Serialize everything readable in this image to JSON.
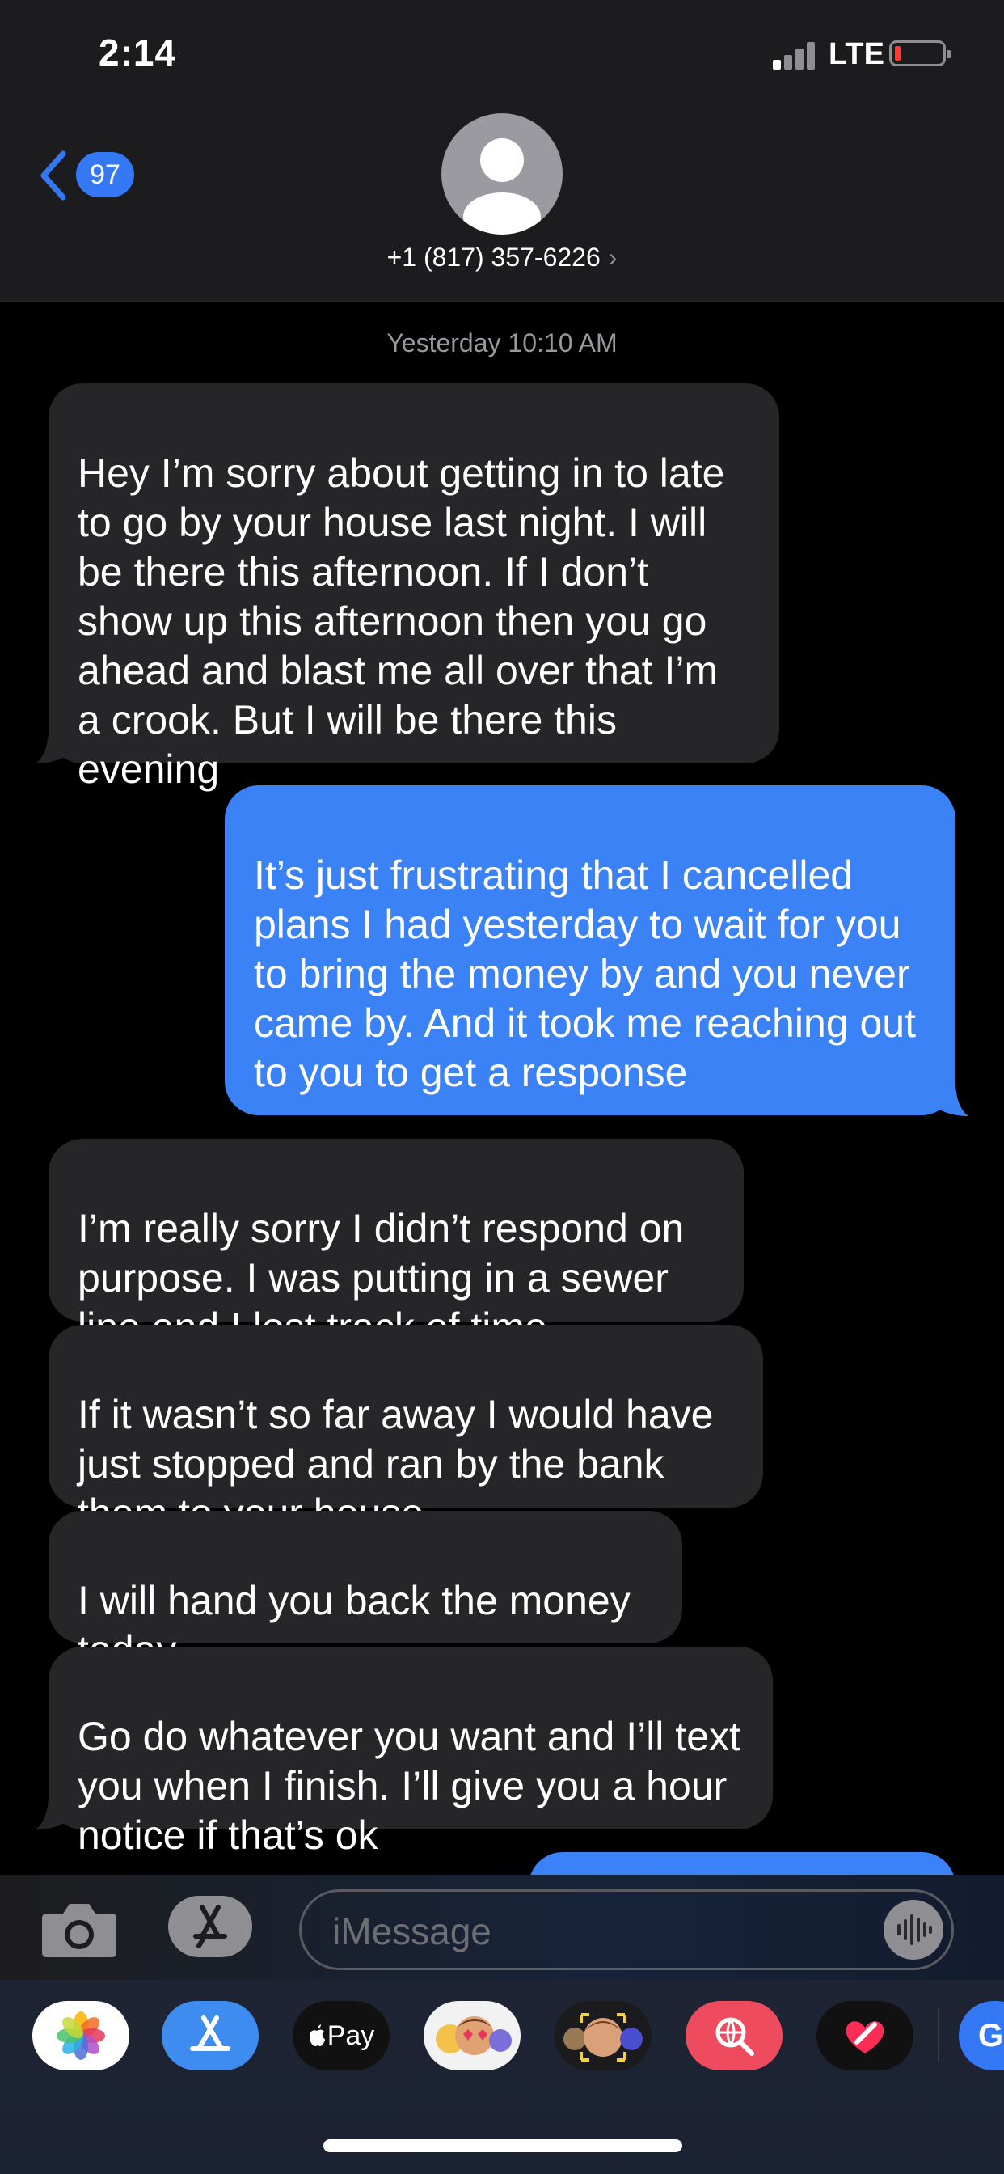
{
  "status_bar": {
    "time": "2:14",
    "network": "LTE"
  },
  "header": {
    "back_count": "97",
    "contact": "+1 (817) 357-6226",
    "chevron": "›"
  },
  "timestamp": "Yesterday 10:10 AM",
  "messages": [
    {
      "from": "them",
      "text": "Hey I’m sorry about  getting in to late to go by your house last night.  I will be there this afternoon.   If I don’t show up this afternoon then you go ahead and blast me all over that I’m a crook.     But I will be there this evening"
    },
    {
      "from": "me",
      "text": "It’s just frustrating that I cancelled plans I had yesterday to wait for you to bring the money by and you never came by. And it took me reaching out to you to get a response"
    },
    {
      "from": "them",
      "text": "I’m really sorry I didn’t respond on purpose.  I was putting in a sewer line and I lost track of time"
    },
    {
      "from": "them",
      "text": "If it wasn’t so far away I would have just stopped and ran by the bank them to your house."
    },
    {
      "from": "them",
      "text": "I will hand you back the money today."
    },
    {
      "from": "them",
      "text": "Go do whatever you want and I’ll text you when I finish.  I’ll give you a hour notice if that’s ok"
    }
  ],
  "composer": {
    "placeholder": "iMessage"
  },
  "app_tray": {
    "apps": [
      {
        "name": "photos-app-icon"
      },
      {
        "name": "app-store-app-icon"
      },
      {
        "name": "apple-pay-app-icon",
        "label": "Pay"
      },
      {
        "name": "memoji-stickers-app-icon"
      },
      {
        "name": "animoji-app-icon"
      },
      {
        "name": "search-images-app-icon"
      },
      {
        "name": "digital-touch-app-icon"
      },
      {
        "name": "partial-app-icon",
        "label": "G"
      }
    ]
  },
  "colors": {
    "sent_bubble": "#3b82f6",
    "received_bubble": "#262628",
    "accent": "#3478f6"
  }
}
